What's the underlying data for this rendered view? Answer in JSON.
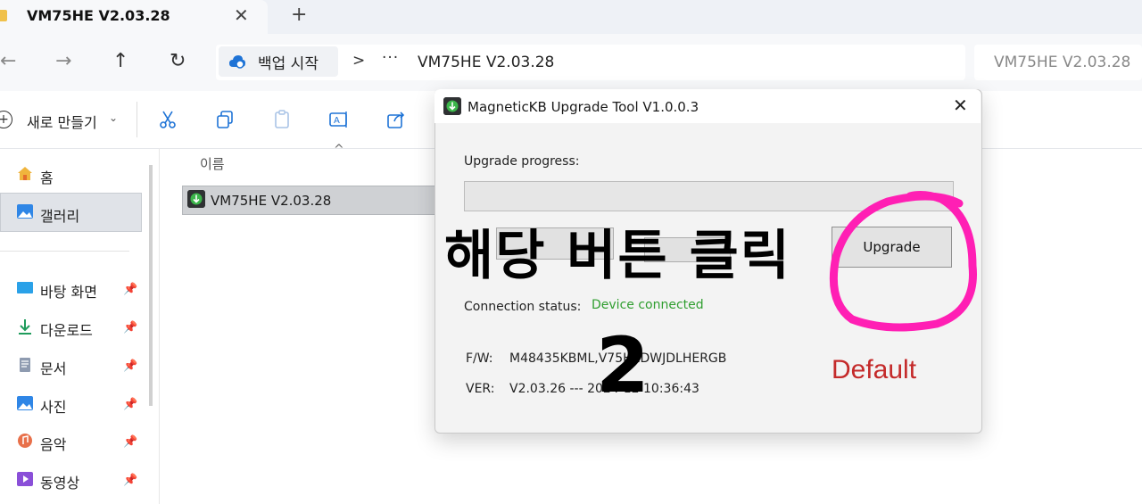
{
  "explorer": {
    "tab": {
      "title": "VM75HE  V2.03.28",
      "close": "✕",
      "new": "+"
    },
    "nav": {
      "back": "←",
      "forward": "→",
      "up": "↑",
      "refresh": "↻"
    },
    "address": {
      "home_crumb": "백업 시작",
      "separator": ">",
      "more": "···",
      "current_folder": "VM75HE  V2.03.28"
    },
    "search": {
      "text": "VM75HE  V2.03.28"
    },
    "commands": {
      "new_label": "새로 만들기",
      "new_caret": "⌄",
      "new_icon": "plus-circle-icon",
      "icons": [
        "cut-icon",
        "copy-icon",
        "paste-icon",
        "rename-icon",
        "share-icon"
      ]
    },
    "sidebar": {
      "items": [
        {
          "label": "홈",
          "icon": "home-icon"
        },
        {
          "label": "갤러리",
          "icon": "gallery-icon",
          "selected": true
        },
        {
          "label": "바탕 화면",
          "icon": "desktop-icon",
          "pinned": true
        },
        {
          "label": "다운로드",
          "icon": "download-icon",
          "pinned": true
        },
        {
          "label": "문서",
          "icon": "documents-icon",
          "pinned": true
        },
        {
          "label": "사진",
          "icon": "pictures-icon",
          "pinned": true
        },
        {
          "label": "음악",
          "icon": "music-icon",
          "pinned": true
        },
        {
          "label": "동영상",
          "icon": "videos-icon",
          "pinned": true
        }
      ],
      "pin_glyph": "📌"
    },
    "file_list": {
      "column_name": "이름",
      "sort_glyph": "^",
      "rows": [
        {
          "name": "VM75HE  V2.03.28",
          "icon": "exe-icon"
        }
      ]
    }
  },
  "dialog": {
    "title": "MagneticKB Upgrade Tool V1.0.0.3",
    "close": "✕",
    "progress_label": "Upgrade progress:",
    "progress_value": 0,
    "progress_color": "#06b025",
    "upgrade_button": "Upgrade",
    "connection_label": "Connection status:",
    "connection_value": "Device connected",
    "connection_color": "#2f9e2f",
    "fw_label": "F/W:",
    "fw_value": "M48435KBML,V75HEDWJDLHERGB",
    "ver_label": "VER:",
    "ver_value": "V2.03.26 --- 2024-12 10:36:43",
    "default_text": "Default",
    "default_color": "#c42a2a"
  },
  "annotation": {
    "text": "해당 버튼 클릭",
    "step": "2",
    "circle_color": "#ff1fb4"
  }
}
